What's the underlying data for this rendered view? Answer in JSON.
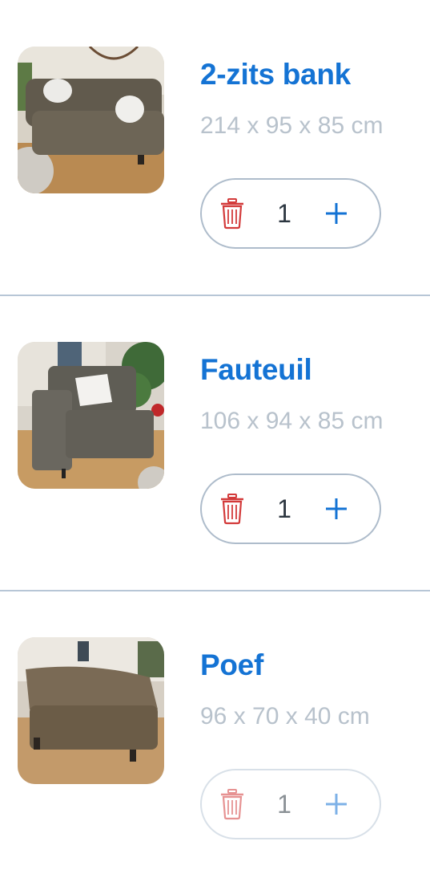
{
  "colors": {
    "title": "#1473d4",
    "dimensions": "#b8c2cc",
    "divider": "#b7c6d6",
    "trash": "#d33a3a",
    "plus": "#1473d4"
  },
  "items": [
    {
      "title": "2-zits bank",
      "dimensions": "214 x 95 x 85 cm",
      "quantity": "1",
      "image_icon": "sofa-photo",
      "trash_icon": "trash-icon",
      "plus_icon": "plus-icon"
    },
    {
      "title": "Fauteuil",
      "dimensions": "106 x 94 x 85 cm",
      "quantity": "1",
      "image_icon": "armchair-photo",
      "trash_icon": "trash-icon",
      "plus_icon": "plus-icon"
    },
    {
      "title": "Poef",
      "dimensions": "96 x 70 x 40 cm",
      "quantity": "1",
      "image_icon": "ottoman-photo",
      "trash_icon": "trash-icon",
      "plus_icon": "plus-icon"
    }
  ]
}
